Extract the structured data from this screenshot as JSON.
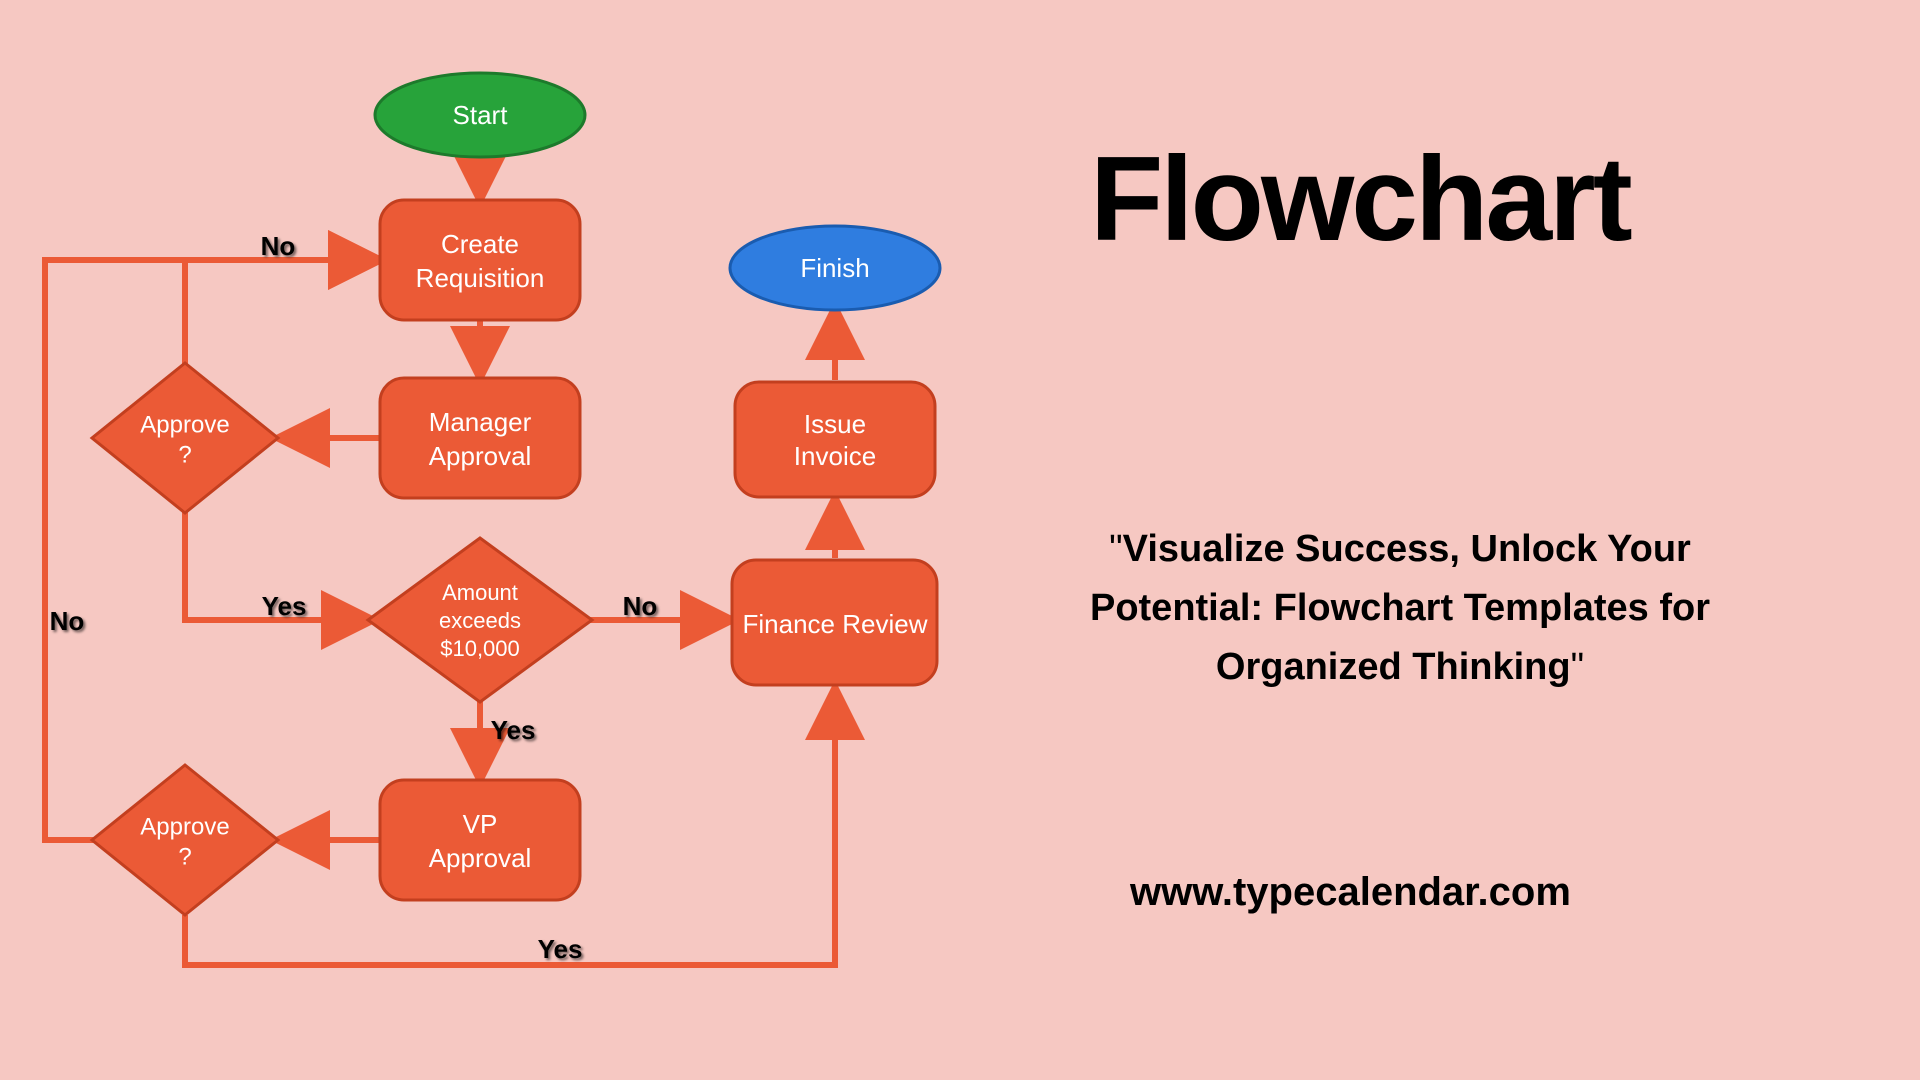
{
  "title": "Flowchart",
  "quote_open": "\"",
  "quote_body": "Visualize Success, Unlock Your Potential: Flowchart Templates for Organized Thinking",
  "quote_close": "\"",
  "url": "www.typecalendar.com",
  "colors": {
    "background": "#f6c8c2",
    "process_fill": "#eb5a36",
    "process_stroke": "#c33f1f",
    "start_fill": "#27a33a",
    "start_stroke": "#1d7a2b",
    "finish_fill": "#2f7de0",
    "finish_stroke": "#1a5cb0",
    "arrow": "#eb5a36",
    "label": "#000000"
  },
  "nodes": {
    "start": "Start",
    "create_l1": "Create",
    "create_l2": "Requisition",
    "mgr_l1": "Manager",
    "mgr_l2": "Approval",
    "approve1_l1": "Approve",
    "approve1_l2": "?",
    "amount_l1": "Amount",
    "amount_l2": "exceeds",
    "amount_l3": "$10,000",
    "vp_l1": "VP",
    "vp_l2": "Approval",
    "approve2_l1": "Approve",
    "approve2_l2": "?",
    "finrev": "Finance Review",
    "issue_l1": "Issue",
    "issue_l2": "Invoice",
    "finish": "Finish"
  },
  "labels": {
    "no1": "No",
    "yes1": "Yes",
    "no2": "No",
    "yes2": "Yes",
    "no3": "No",
    "yes3": "Yes"
  },
  "flow": [
    {
      "from": "Start",
      "to": "Create Requisition"
    },
    {
      "from": "Create Requisition",
      "to": "Manager Approval"
    },
    {
      "from": "Manager Approval",
      "to": "Approve? (1)"
    },
    {
      "from": "Approve? (1)",
      "to": "Create Requisition",
      "label": "No"
    },
    {
      "from": "Approve? (1)",
      "to": "Amount exceeds $10,000",
      "label": "Yes"
    },
    {
      "from": "Amount exceeds $10,000",
      "to": "Finance Review",
      "label": "No"
    },
    {
      "from": "Amount exceeds $10,000",
      "to": "VP Approval",
      "label": "Yes"
    },
    {
      "from": "VP Approval",
      "to": "Approve? (2)"
    },
    {
      "from": "Approve? (2)",
      "to": "Create Requisition",
      "label": "No"
    },
    {
      "from": "Approve? (2)",
      "to": "Finance Review",
      "label": "Yes"
    },
    {
      "from": "Finance Review",
      "to": "Issue Invoice"
    },
    {
      "from": "Issue Invoice",
      "to": "Finish"
    }
  ]
}
